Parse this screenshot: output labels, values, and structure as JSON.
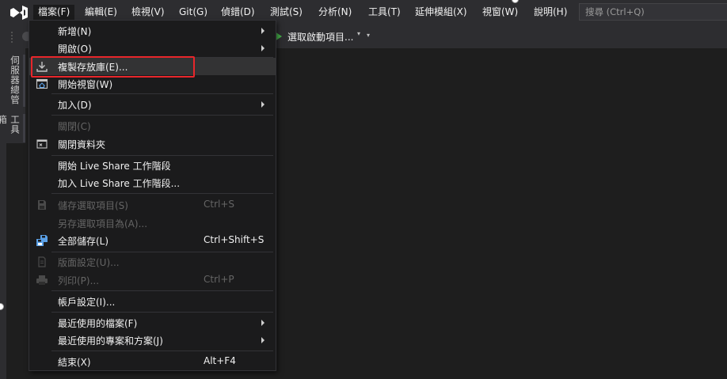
{
  "menubar": {
    "items": [
      {
        "label": "檔案(F)"
      },
      {
        "label": "編輯(E)"
      },
      {
        "label": "檢視(V)"
      },
      {
        "label": "Git(G)"
      },
      {
        "label": "偵錯(D)"
      },
      {
        "label": "測試(S)"
      },
      {
        "label": "分析(N)"
      },
      {
        "label": "工具(T)"
      },
      {
        "label": "延伸模組(X)"
      },
      {
        "label": "視窗(W)"
      },
      {
        "label": "說明(H)"
      }
    ],
    "search_placeholder": "搜尋 (Ctrl+Q)"
  },
  "toolbar": {
    "start_label": "選取啟動項目...",
    "start_dropdown": "▾",
    "more": "▾"
  },
  "side_tabs": {
    "server_explorer": "伺服器總管",
    "toolbox": "工具箱"
  },
  "file_menu": {
    "new": "新增(N)",
    "open": "開啟(O)",
    "clone_repo": "複製存放庫(E)...",
    "start_window": "開始視窗(W)",
    "add": "加入(D)",
    "close": "關閉(C)",
    "close_folder": "關閉資料夾",
    "start_live_share": "開始 Live Share 工作階段",
    "join_live_share": "加入 Live Share 工作階段...",
    "save_selected": "儲存選取項目(S)",
    "save_selected_shortcut": "Ctrl+S",
    "save_selected_as": "另存選取項目為(A)...",
    "save_all": "全部儲存(L)",
    "save_all_shortcut": "Ctrl+Shift+S",
    "page_setup": "版面設定(U)...",
    "print": "列印(P)...",
    "print_shortcut": "Ctrl+P",
    "account_settings": "帳戶設定(I)...",
    "recent_files": "最近使用的檔案(F)",
    "recent_projects": "最近使用的專案和方案(J)",
    "exit": "結束(X)",
    "exit_shortcut": "Alt+F4"
  },
  "colors": {
    "menubar_bg": "#2d2d30",
    "menu_bg": "#1b1b1c",
    "highlight_box": "#e8262b",
    "vs_logo": "#ffffff"
  }
}
